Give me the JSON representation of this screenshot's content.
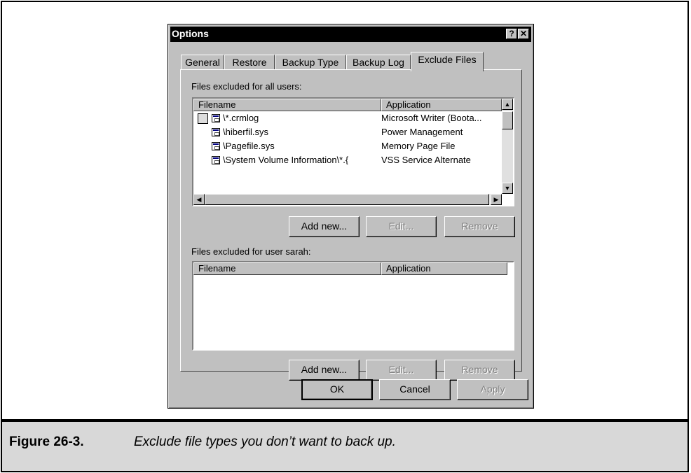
{
  "dialog": {
    "title": "Options",
    "help_button": "?",
    "close_button": "✕",
    "tabs": [
      "General",
      "Restore",
      "Backup Type",
      "Backup Log",
      "Exclude Files"
    ],
    "active_tab": "Exclude Files"
  },
  "all_users": {
    "label": "Files excluded for all users:",
    "columns": [
      "Filename",
      "Application"
    ],
    "rows": [
      {
        "filename": "\\*.crmlog",
        "application": "Microsoft Writer (Boota..."
      },
      {
        "filename": "\\hiberfil.sys",
        "application": "Power Management"
      },
      {
        "filename": "\\Pagefile.sys",
        "application": "Memory Page File"
      },
      {
        "filename": "\\System Volume Information\\*.{",
        "application": "VSS Service Alternate"
      }
    ],
    "buttons": {
      "add": "Add new...",
      "edit": "Edit...",
      "remove": "Remove"
    }
  },
  "user": {
    "label": "Files excluded for user sarah:",
    "columns": [
      "Filename",
      "Application"
    ],
    "buttons": {
      "add": "Add new...",
      "edit": "Edit...",
      "remove": "Remove"
    }
  },
  "footer": {
    "ok": "OK",
    "cancel": "Cancel",
    "apply": "Apply"
  },
  "caption": {
    "label": "Figure 26-3.",
    "text": "Exclude file types you don’t want to back up."
  },
  "icons": [
    "folder-icon",
    "file-icon",
    "scroll-up-icon",
    "scroll-down-icon",
    "scroll-left-icon",
    "scroll-right-icon"
  ]
}
